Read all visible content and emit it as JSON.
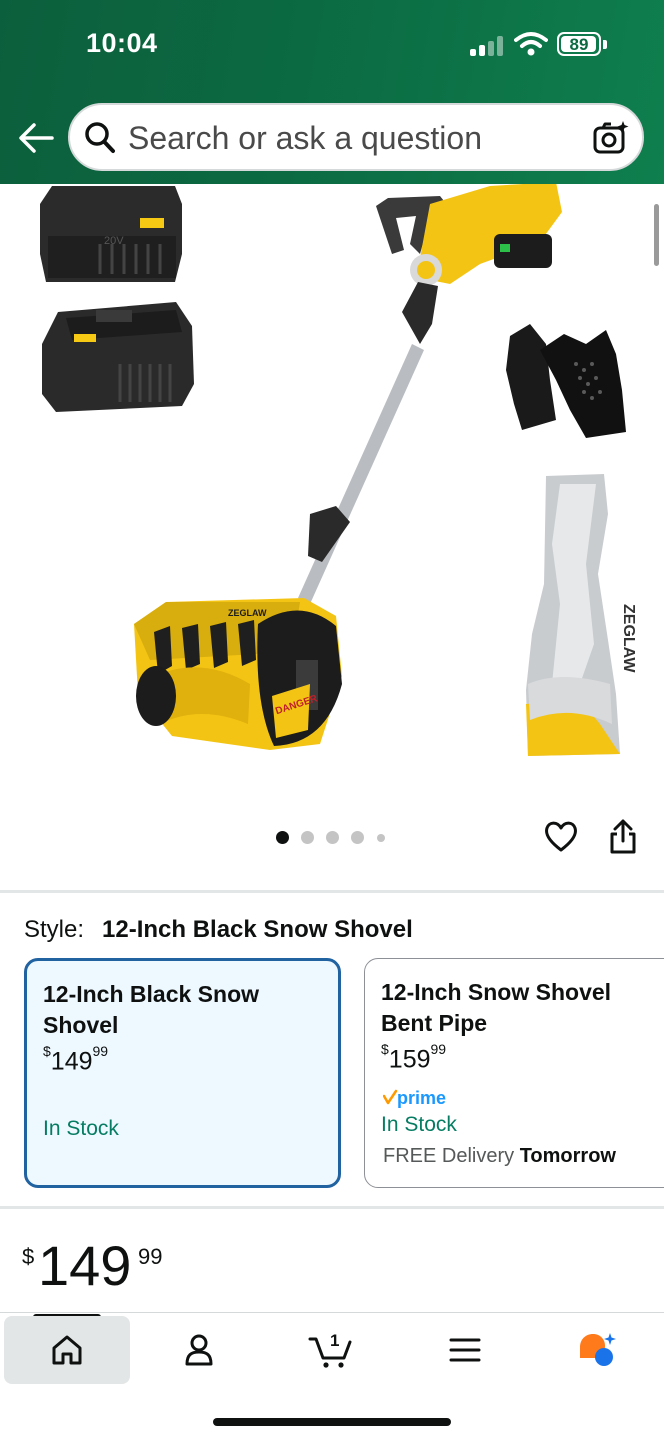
{
  "status_bar": {
    "time": "10:04",
    "battery": "89"
  },
  "search": {
    "placeholder": "Search or ask a question"
  },
  "gallery": {
    "image_count": 5,
    "active_index": 0,
    "battery_label": "20V",
    "brand_label": "ZEGLAW",
    "warning_label": "DANGER"
  },
  "style": {
    "label": "Style:",
    "selected": "12-Inch Black Snow Shovel",
    "options": [
      {
        "title": "12-Inch Black Snow Shovel",
        "price_currency": "$",
        "price_whole": "149",
        "price_fraction": "99",
        "stock": "In Stock",
        "prime": false
      },
      {
        "title": "12-Inch Snow Shovel Bent Pipe",
        "price_currency": "$",
        "price_whole": "159",
        "price_fraction": "99",
        "prime_label": "prime",
        "stock": "In Stock",
        "delivery_prefix": "FREE Delivery",
        "delivery_day": "Tomorrow"
      }
    ]
  },
  "price": {
    "currency": "$",
    "whole": "149",
    "fraction": "99"
  },
  "nav": {
    "items": [
      "home",
      "account",
      "cart",
      "menu",
      "rufus"
    ],
    "cart_count": "1",
    "active": "home"
  },
  "colors": {
    "header_green": "#0b6a42",
    "accent_yellow": "#f6c915",
    "selected_border": "#2162a1",
    "selected_bg": "#edf8ff",
    "stock_green": "#067d62",
    "prime_blue": "#1a98ff",
    "prime_orange": "#ff9900"
  }
}
